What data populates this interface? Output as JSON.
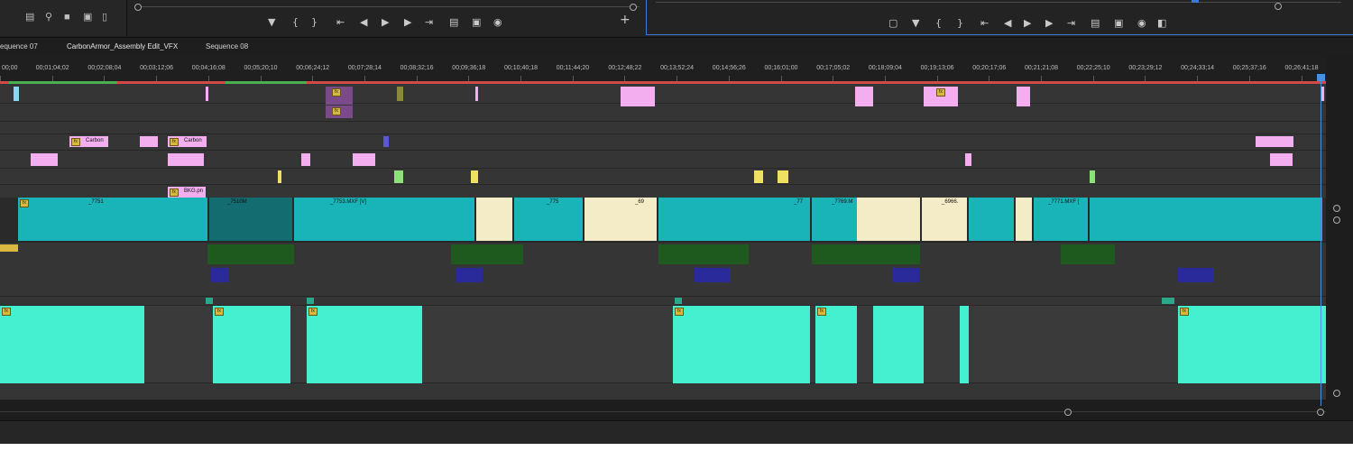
{
  "project_toolbar": {
    "icons": [
      "list-view-icon",
      "search-icon",
      "new-bin-icon",
      "new-item-icon",
      "trash-icon"
    ]
  },
  "source_monitor": {
    "icons": [
      "add-marker-icon",
      "mark-in-icon",
      "mark-out-icon",
      "go-to-in-icon",
      "step-back-icon",
      "play-icon",
      "step-forward-icon",
      "go-to-out-icon",
      "insert-icon",
      "overwrite-icon",
      "export-frame-icon",
      "button-editor-icon"
    ]
  },
  "program_monitor": {
    "icons": [
      "safe-margins-icon",
      "add-marker-icon",
      "mark-in-icon",
      "mark-out-icon",
      "go-to-in-icon",
      "step-back-icon",
      "play-icon",
      "step-forward-icon",
      "go-to-out-icon",
      "lift-icon",
      "extract-icon",
      "export-frame-icon",
      "compare-view-icon"
    ]
  },
  "sequence_tabs": [
    "equence 07",
    "CarbonArmor_Assembly Edit_VFX",
    "Sequence 08"
  ],
  "ruler": {
    "timecodes": [
      "00;00",
      "00;01;04;02",
      "00;02;08;04",
      "00;03;12;06",
      "00;04;16;08",
      "00;05;20;10",
      "00;06;24;12",
      "00;07;28;14",
      "00;08;32;16",
      "00;09;36;18",
      "00;10;40;18",
      "00;11;44;20",
      "00;12;48;22",
      "00;13;52;24",
      "00;14;56;26",
      "00;16;01;00",
      "00;17;05;02",
      "00;18;09;04",
      "00;19;13;06",
      "00;20;17;06",
      "00;21;21;08",
      "00;22;25;10",
      "00;23;29;12",
      "00;24;33;14",
      "00;25;37;16",
      "00;26;41;18"
    ]
  },
  "clip_labels": {
    "carbon_1": "Carbon",
    "carbon_2": "Carbon",
    "bkg": "BKG.pn",
    "v1_a": "_7751",
    "v1_b": "_7751.MXF",
    "v1_c": "_7510M",
    "v1_d": "_7753.MXF [V]",
    "v1_e": "_775",
    "v1_f": "_69",
    "v1_g": "_77",
    "v1_h": "_7769.M",
    "v1_i": "_6966.",
    "v1_j": "_7771.MXF ["
  },
  "colors": {
    "pink": "#f3aef0",
    "lightblue": "#8fd3f0",
    "purple": "#7a4a8a",
    "olive": "#8a8a3a",
    "yellow": "#f0e060",
    "lightgreen": "#8ee07a",
    "blue": "#5a58d8",
    "green": "#4aa040",
    "teal": "#18b4b8",
    "cream": "#f4ecc6",
    "audio_cyan": "#44f0d0",
    "darkgreen": "#1e5a1e",
    "darkblue": "#2a2a9a",
    "accent_blue": "#3b7bd8"
  }
}
